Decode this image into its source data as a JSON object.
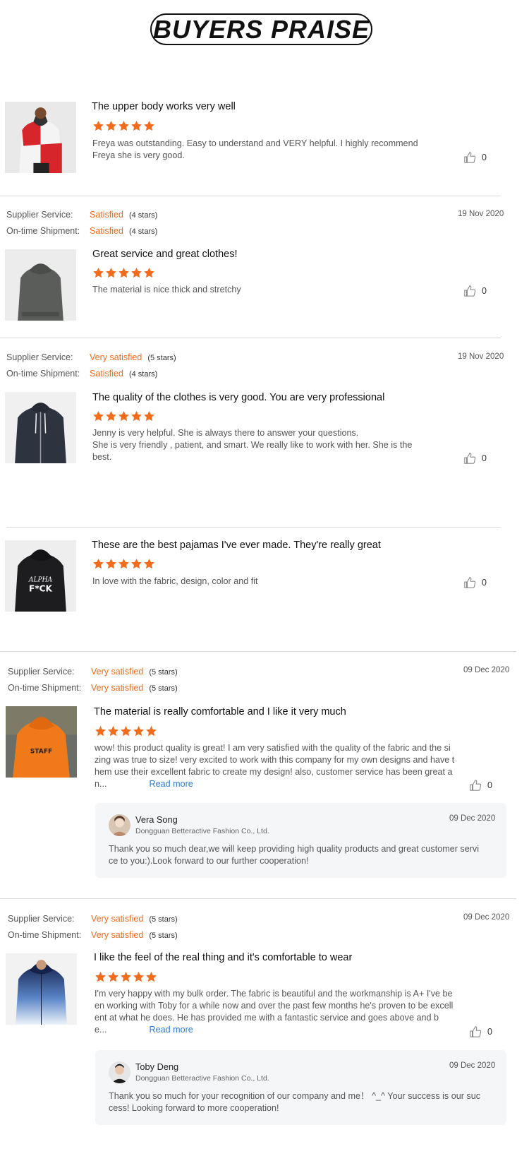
{
  "page": {
    "heading": "BUYERS PRAISE",
    "colors": {
      "accent": "#f26c1e",
      "link": "#2f7bd6",
      "reply_bg": "#f5f6f8",
      "rule": "#d9d9d9"
    }
  },
  "labels": {
    "supplier_service": "Supplier Service:",
    "ontime_shipment": "On-time Shipment:",
    "read_more": "Read more"
  },
  "reviews": [
    {
      "title": "The upper body works very well",
      "rating": 5,
      "body": [
        "Freya was outstanding. Easy to understand and VERY helpful. I highly recommend",
        "Freya she is very good."
      ],
      "likes": "0",
      "image_icon": "hoodie-red-white-photo"
    },
    {
      "supplier_service": "Satisfied",
      "supplier_stars": "(4 stars)",
      "shipment": "Satisfied",
      "shipment_stars": "(4 stars)",
      "date": "19 Nov 2020",
      "title": "Great service and great clothes!",
      "rating": 5,
      "body": [
        "The material is nice thick and stretchy"
      ],
      "likes": "0",
      "image_icon": "hoodie-grey-back-photo"
    },
    {
      "supplier_service": "Very satisfied",
      "supplier_stars": "(5 stars)",
      "shipment": "Satisfied",
      "shipment_stars": "(4 stars)",
      "date": "19 Nov 2020",
      "title": "The quality of the clothes is very good. You are very professional",
      "rating": 5,
      "body": [
        "Jenny is very helpful. She is always there to answer your questions.",
        "She is  very friendly , patient, and smart. We really like to work with her. She is the",
        "best."
      ],
      "likes": "0",
      "image_icon": "hoodie-navy-zip-photo"
    },
    {
      "title": "These are the best pajamas I've ever made. They're really great",
      "rating": 5,
      "body": [
        "In love with the fabric, design,  color and fit"
      ],
      "likes": "0",
      "image_icon": "hoodie-black-print-photo"
    },
    {
      "supplier_service": "Very satisfied",
      "supplier_stars": "(5 stars)",
      "shipment": "Very satisfied",
      "shipment_stars": "(5 stars)",
      "date": "09 Dec 2020",
      "title": "The material is really comfortable and I like it very much",
      "rating": 5,
      "body": [
        "wow! this product quality is great! I am very satisfied with the quality of the fabric and the si",
        "zing was true to size! very excited to work with this company for my own designs and have t",
        "hem use their excellent fabric to create my design! also, customer service has been great a"
      ],
      "body_tail": "n...",
      "likes": "0",
      "image_icon": "hoodie-orange-photo",
      "reply": {
        "name": "Vera Song",
        "company": "Dongguan Betteractive Fashion Co., Ltd.",
        "date": "09 Dec 2020",
        "text": [
          "Thank you so much dear,we will keep providing high quality products and great customer servi",
          "ce to you:).Look forward to our further cooperation!"
        ]
      }
    },
    {
      "supplier_service": "Very satisfied",
      "supplier_stars": "(5 stars)",
      "shipment": "Very satisfied",
      "shipment_stars": "(5 stars)",
      "date": "09 Dec 2020",
      "title": "I like the feel of the real thing and it's comfortable to wear",
      "rating": 5,
      "body": [
        "I'm very happy with my bulk order. The fabric is beautiful and the workmanship is A+ I've be",
        "en working with Toby for a while now and over the past few months he's proven to be excell",
        "ent at what he does. He has provided me with a fantastic service and goes above and b"
      ],
      "body_tail": "e...",
      "likes": "0",
      "image_icon": "hoodie-blue-gradient-photo",
      "reply": {
        "name": "Toby Deng",
        "company": "Dongguan Betteractive Fashion Co., Ltd.",
        "date": "09 Dec 2020",
        "text": [
          "Thank you so much for your recognition of our company and me！ ^_^ Your success is our suc",
          "cess! Looking forward to more cooperation!"
        ]
      }
    }
  ]
}
